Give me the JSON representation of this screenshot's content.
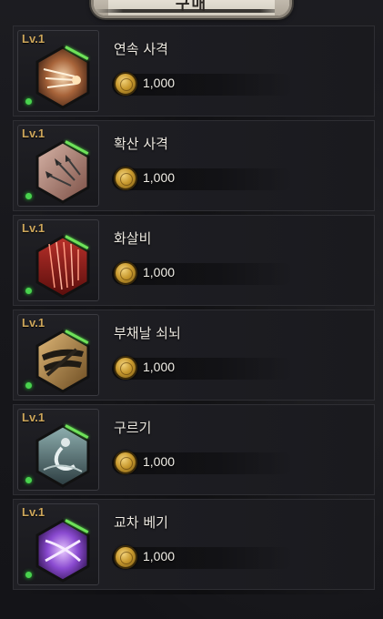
{
  "header": {
    "title": "구매"
  },
  "skills": [
    {
      "level": "Lv.1",
      "name": "연속 사격",
      "price": "1,000",
      "icon": "rapid-fire-icon"
    },
    {
      "level": "Lv.1",
      "name": "확산 사격",
      "price": "1,000",
      "icon": "spread-shot-icon"
    },
    {
      "level": "Lv.1",
      "name": "화살비",
      "price": "1,000",
      "icon": "arrow-rain-icon"
    },
    {
      "level": "Lv.1",
      "name": "부채날 쇠뇌",
      "price": "1,000",
      "icon": "fan-blade-crossbow-icon"
    },
    {
      "level": "Lv.1",
      "name": "구르기",
      "price": "1,000",
      "icon": "roll-icon"
    },
    {
      "level": "Lv.1",
      "name": "교차 베기",
      "price": "1,000",
      "icon": "cross-slash-icon"
    }
  ],
  "colors": {
    "level_text": "#cda65a",
    "status_green": "#49d24e",
    "coin_gold": "#c99a2f",
    "header_tab": "#ece7dc"
  }
}
